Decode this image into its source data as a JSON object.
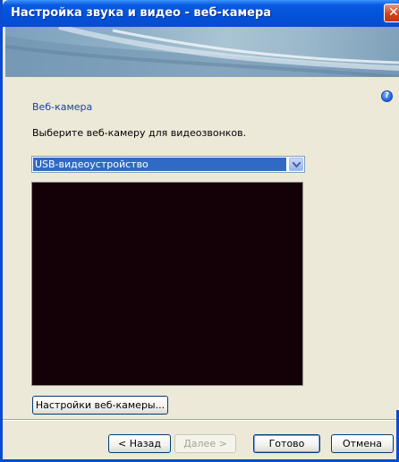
{
  "window": {
    "title": "Настройка звука и видео - веб-камера",
    "close_glyph": "✕"
  },
  "help_icon_glyph": "?",
  "section": {
    "title": "Веб-камера",
    "description": "Выберите веб-камеру для видеозвонков."
  },
  "camera_select": {
    "selected": "USB-видеоустройство"
  },
  "preview": {
    "background": "#140007"
  },
  "buttons": {
    "camera_settings": "Настройки веб-камеры...",
    "back": "< Назад",
    "next": "Далее >",
    "finish": "Готово",
    "cancel": "Отмена"
  },
  "colors": {
    "titlebar": "#0a4bd1",
    "dialog_bg": "#ece9d8",
    "selection": "#316ac5",
    "section_title": "#1a3fa3"
  }
}
